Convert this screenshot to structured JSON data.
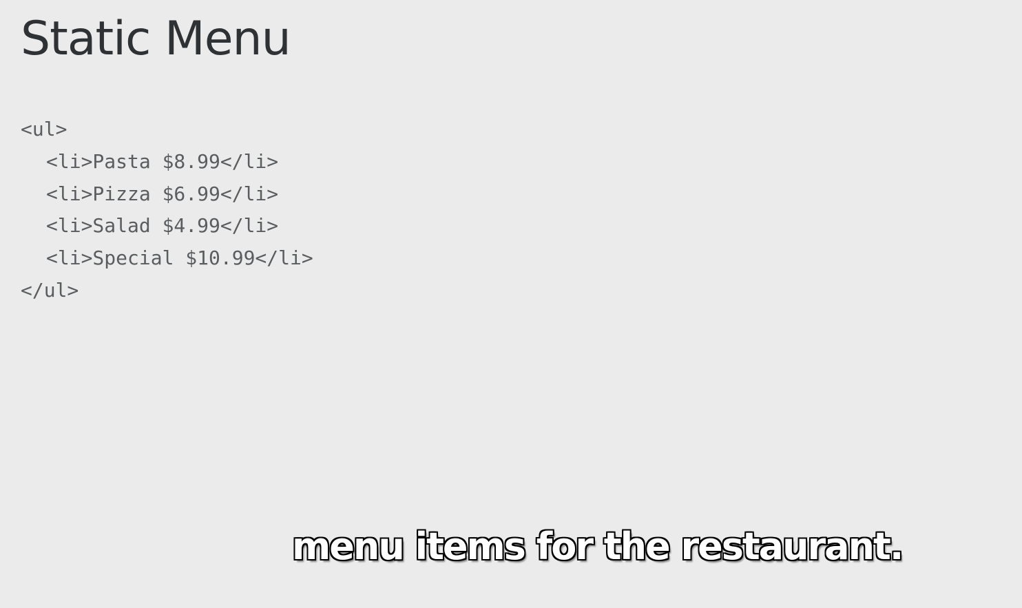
{
  "slide": {
    "title": "Static Menu"
  },
  "code": {
    "lines": [
      "<ul>",
      "<li>Pasta $8.99</li>",
      "<li>Pizza $6.99</li>",
      "<li>Salad $4.99</li>",
      "<li>Special $10.99</li>",
      "</ul>"
    ]
  },
  "caption": {
    "text": "menu items for the restaurant."
  },
  "colors": {
    "background": "#ebebeb",
    "title": "#2f3234",
    "code": "#5a5d60",
    "caption_fill": "#ffffff",
    "caption_outline": "#000000"
  }
}
